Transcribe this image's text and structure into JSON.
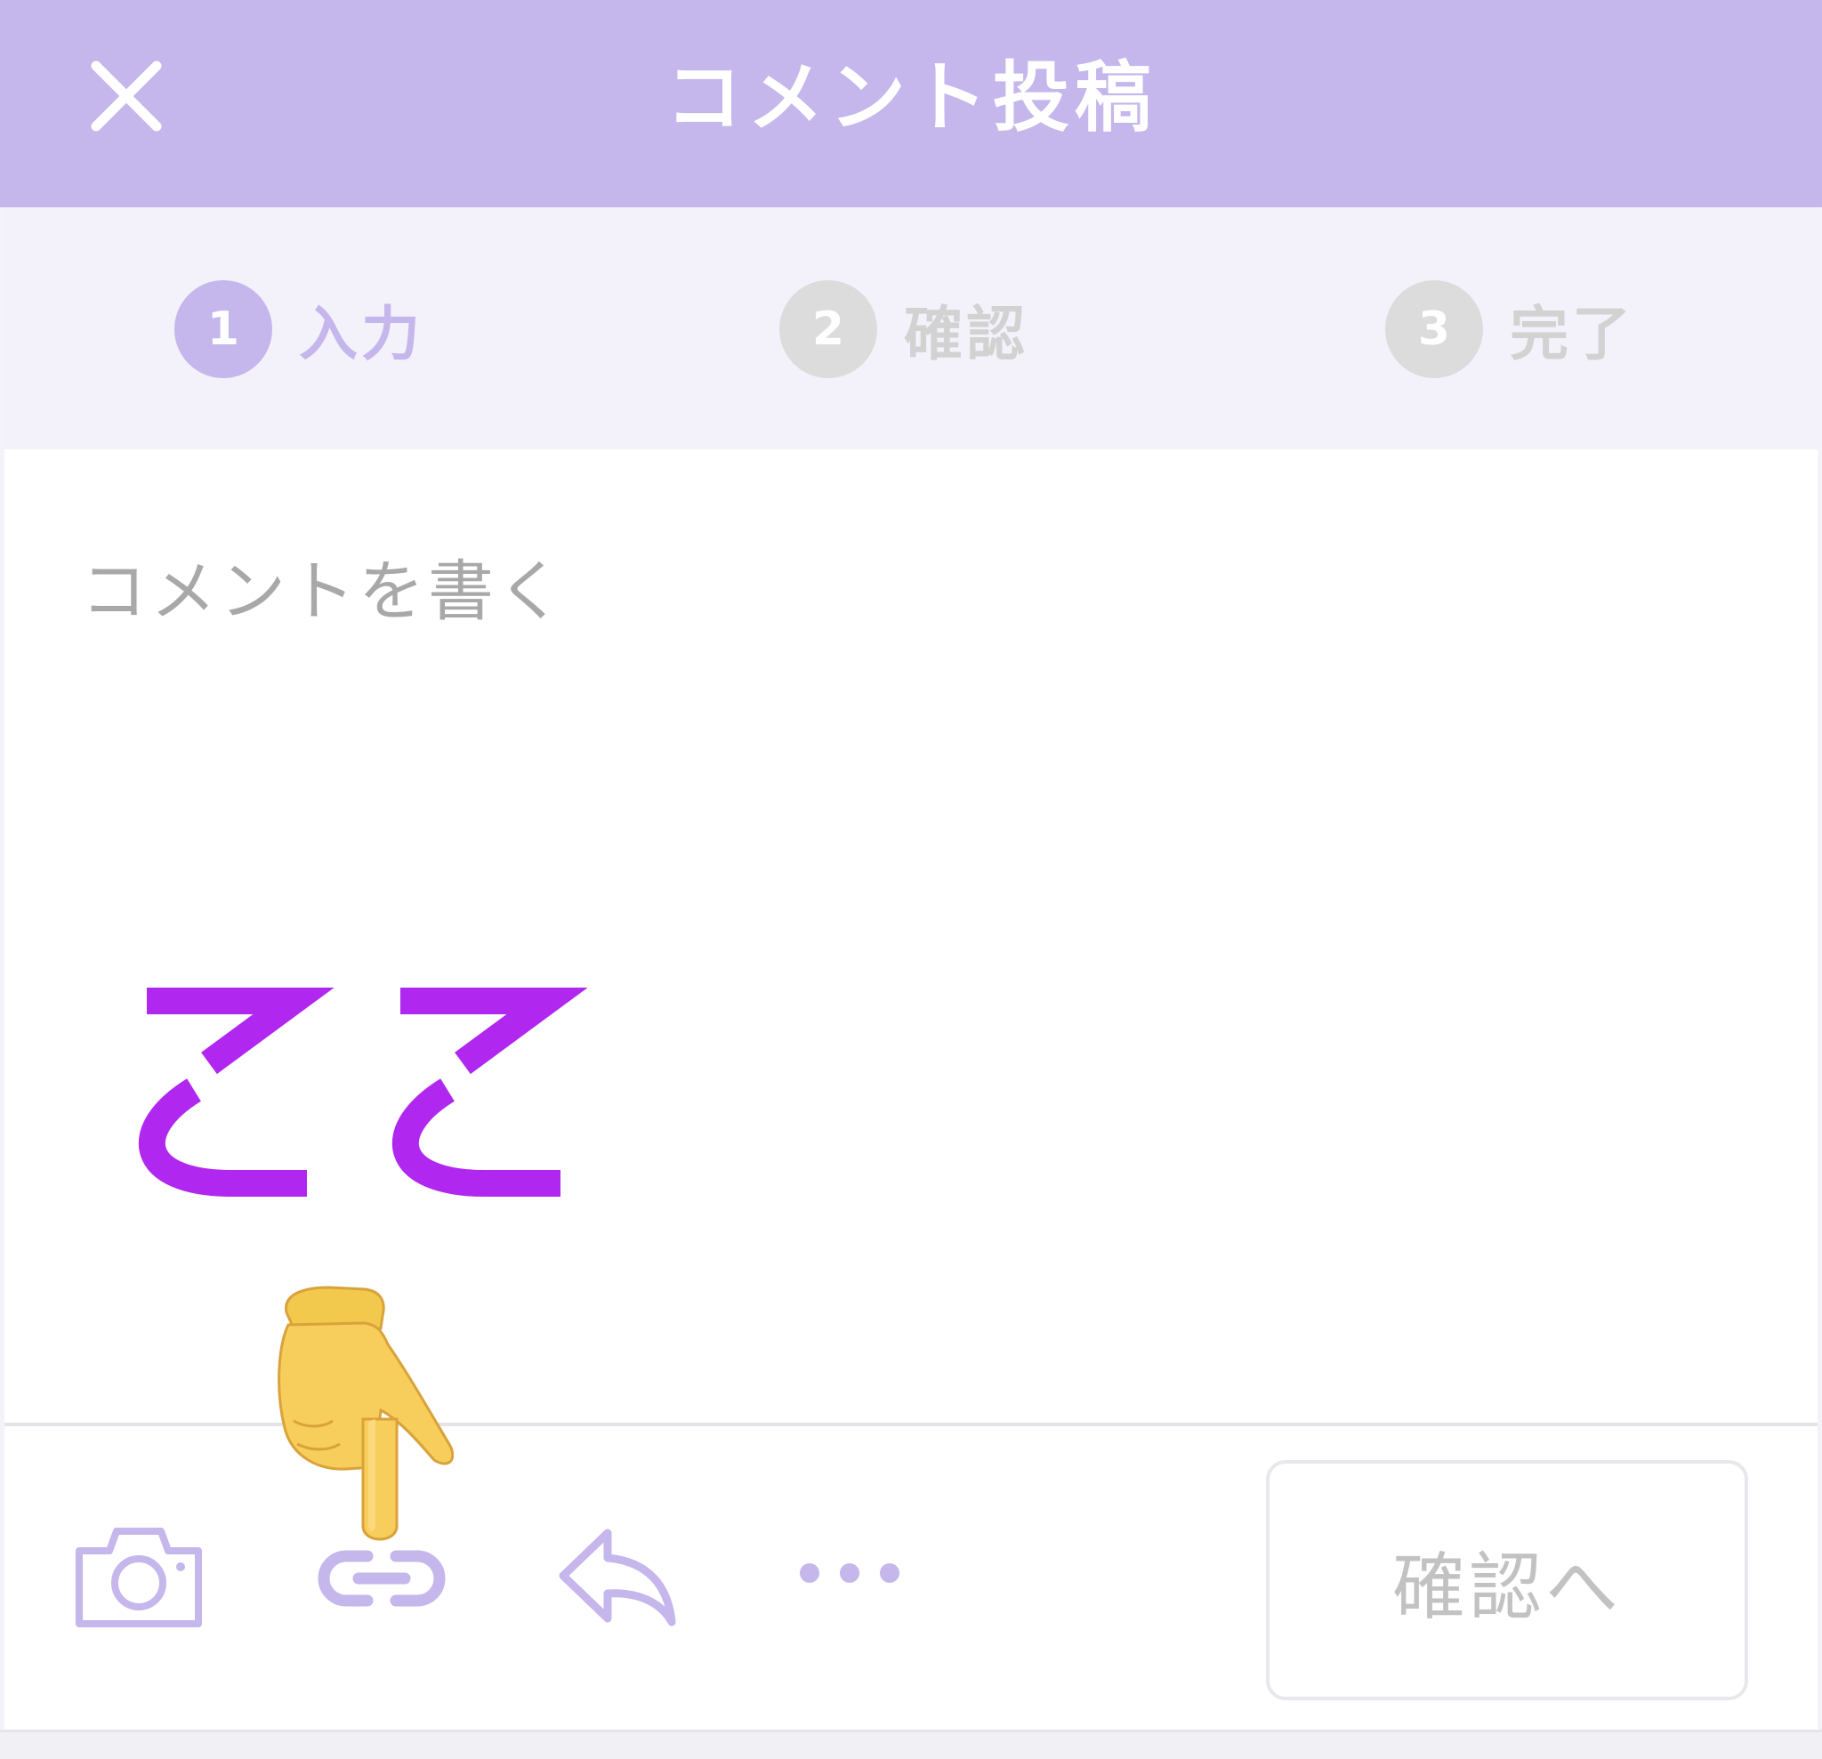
{
  "header": {
    "title": "コメント投稿",
    "close_icon": "close-icon",
    "background_color": "#c5b6ec"
  },
  "steps": [
    {
      "number": "1",
      "label": "入力",
      "state": "active"
    },
    {
      "number": "2",
      "label": "確認",
      "state": "inactive"
    },
    {
      "number": "3",
      "label": "完了",
      "state": "inactive"
    }
  ],
  "comment": {
    "placeholder": "コメントを書く",
    "value": ""
  },
  "annotation": {
    "text": "ここ",
    "color": "#b027f0"
  },
  "toolbar": {
    "icons": [
      "camera-icon",
      "link-icon",
      "reply-icon",
      "more-icon"
    ],
    "icon_color": "#c5b6ec",
    "confirm_label": "確認へ"
  },
  "pointer": {
    "icon": "pointing-down-hand-icon"
  }
}
